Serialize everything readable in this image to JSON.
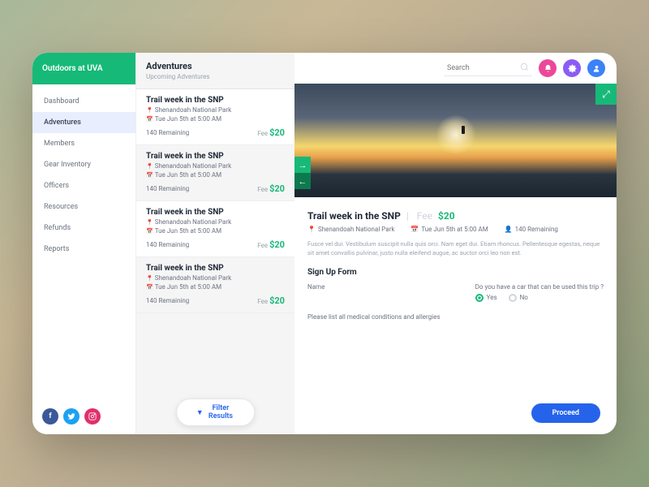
{
  "brand": "Outdoors at UVA",
  "nav": [
    "Dashboard",
    "Adventures",
    "Members",
    "Gear Inventory",
    "Officers",
    "Resources",
    "Refunds",
    "Reports"
  ],
  "navActive": 1,
  "listHead": {
    "title": "Adventures",
    "subtitle": "Upcoming Adventures"
  },
  "adventures": [
    {
      "title": "Trail week in the SNP",
      "location": "Shenandoah National Park",
      "date": "Tue Jun 5th at 5:00 AM",
      "remaining": "140 Remaining",
      "feeLabel": "Fee",
      "feeAmount": "$20"
    },
    {
      "title": "Trail week in the SNP",
      "location": "Shenandoah National Park",
      "date": "Tue Jun 5th at 5:00 AM",
      "remaining": "140 Remaining",
      "feeLabel": "Fee",
      "feeAmount": "$20"
    },
    {
      "title": "Trail week in the SNP",
      "location": "Shenandoah National Park",
      "date": "Tue Jun 5th at 5:00 AM",
      "remaining": "140 Remaining",
      "feeLabel": "Fee",
      "feeAmount": "$20"
    },
    {
      "title": "Trail week in the SNP",
      "location": "Shenandoah National Park",
      "date": "Tue Jun 5th at 5:00 AM",
      "remaining": "140 Remaining",
      "feeLabel": "Fee",
      "feeAmount": "$20"
    }
  ],
  "filterBtn": "Filter Results",
  "search": {
    "placeholder": "Search"
  },
  "detail": {
    "title": "Trail week in the SNP",
    "feeLabel": "Fee",
    "feeAmount": "$20",
    "location": "Shenandoah National Park",
    "date": "Tue Jun 5th at 5:00 AM",
    "remaining": "140 Remaining",
    "desc": "Fusce vel dui. Vestibulum suscipit nulla quis orci. Nam eget dui. Etiam rhoncus. Pellentesque egestas, neque sit amet convallis pulvinar, justo nulla eleifend augue, ac auctor orci leo non est.",
    "formTitle": "Sign Up Form",
    "nameLabel": "Name",
    "carQuestion": "Do you have a car that can be used this trip ?",
    "yes": "Yes",
    "no": "No",
    "medicalLabel": "Please list all medical conditions and allergies",
    "proceed": "Proceed"
  }
}
